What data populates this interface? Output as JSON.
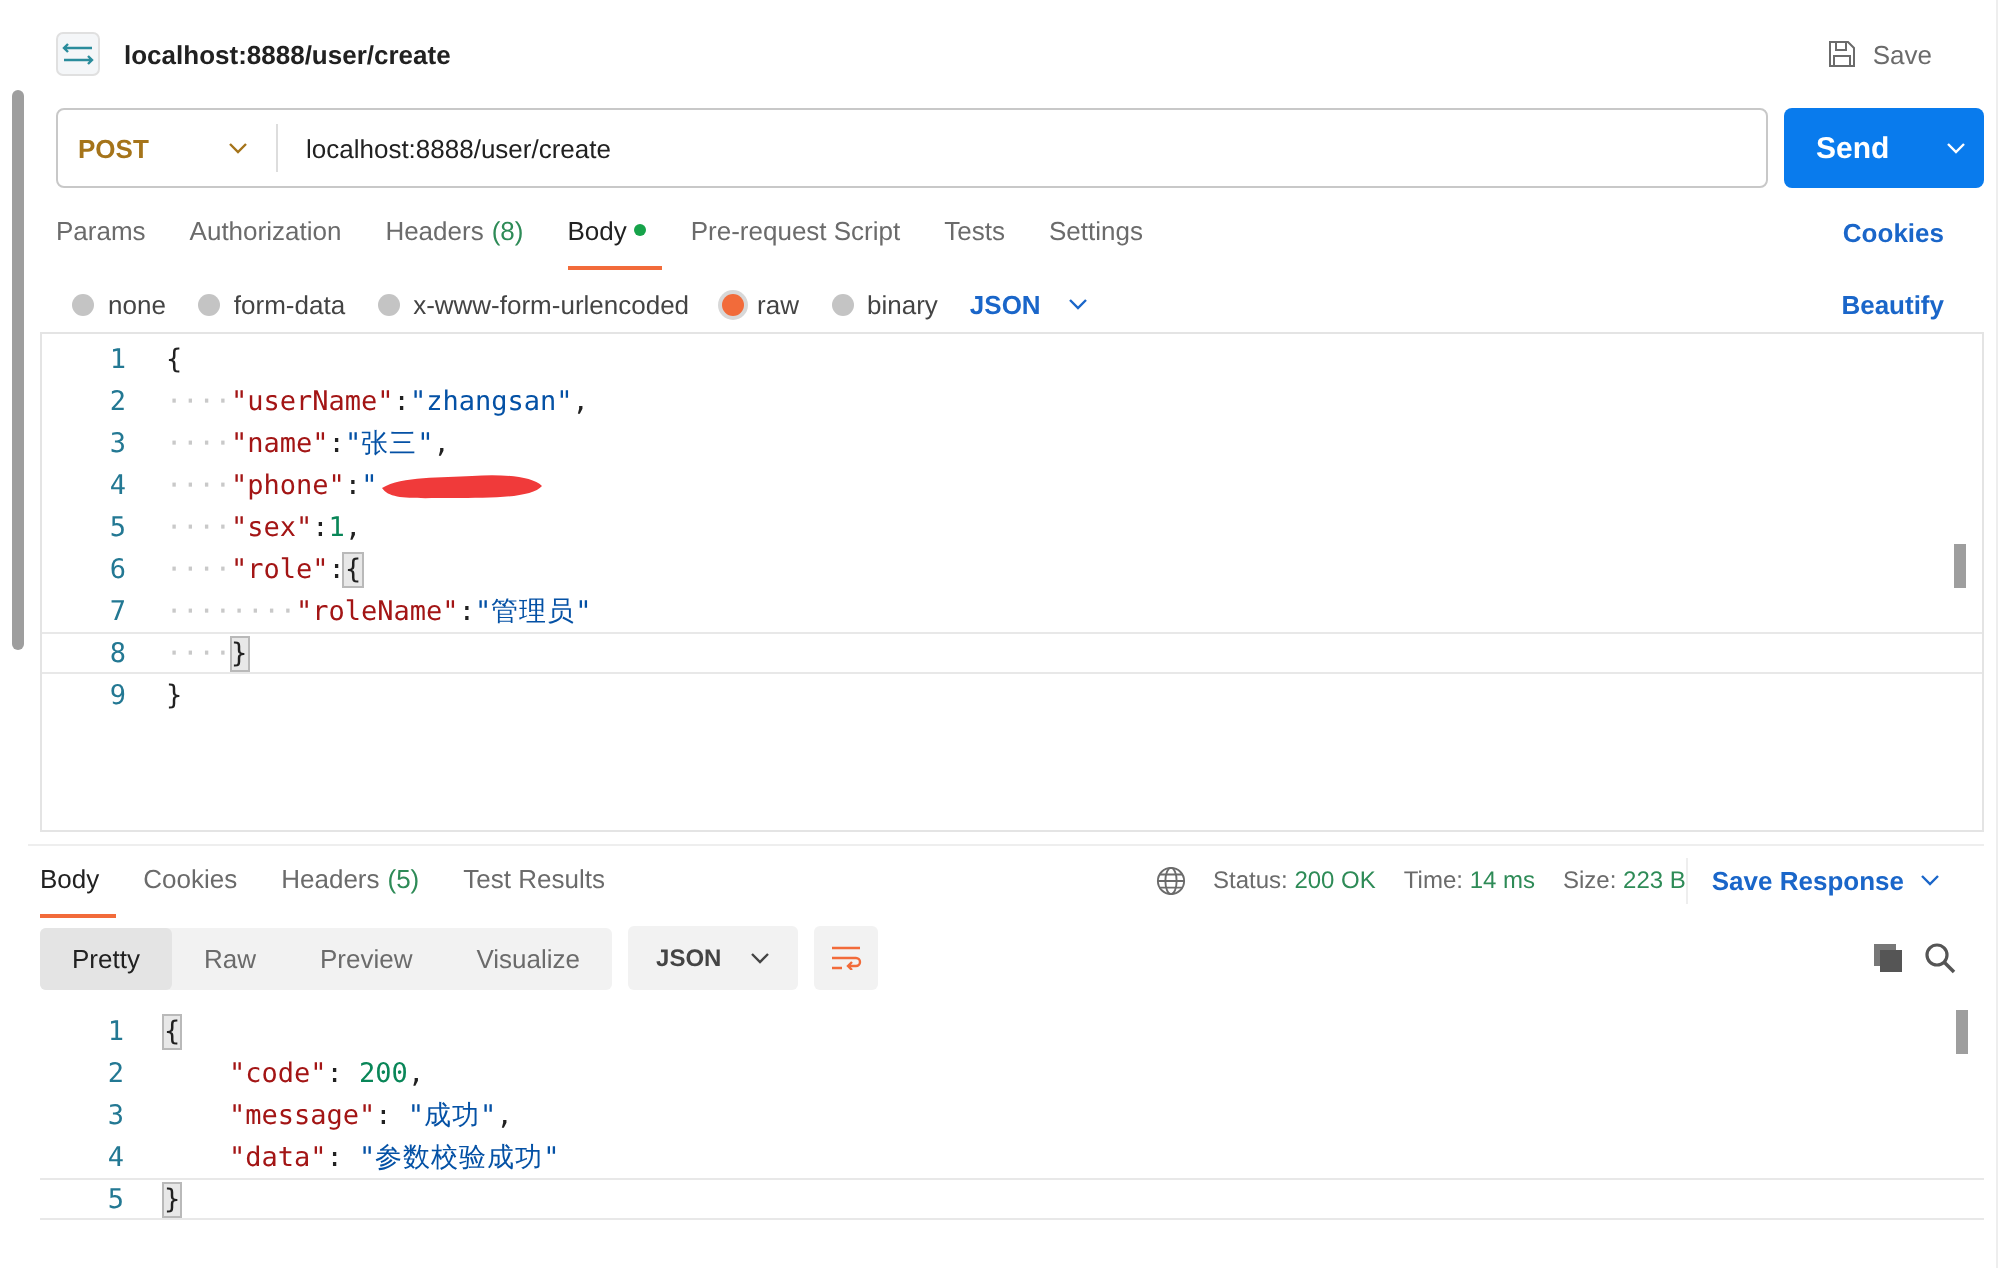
{
  "request": {
    "title": "localhost:8888/user/create",
    "save_label": "Save",
    "method": "POST",
    "url": "localhost:8888/user/create",
    "send_label": "Send"
  },
  "request_tabs": [
    {
      "label": "Params",
      "selected": false,
      "dot": false
    },
    {
      "label": "Authorization",
      "selected": false,
      "dot": false
    },
    {
      "label": "Headers",
      "count": "(8)",
      "selected": false,
      "dot": false
    },
    {
      "label": "Body",
      "selected": true,
      "dot": true
    },
    {
      "label": "Pre-request Script",
      "selected": false,
      "dot": false
    },
    {
      "label": "Tests",
      "selected": false,
      "dot": false
    },
    {
      "label": "Settings",
      "selected": false,
      "dot": false
    }
  ],
  "cookies_link": "Cookies",
  "body_modes": [
    {
      "label": "none",
      "selected": false
    },
    {
      "label": "form-data",
      "selected": false
    },
    {
      "label": "x-www-form-urlencoded",
      "selected": false
    },
    {
      "label": "raw",
      "selected": true
    },
    {
      "label": "binary",
      "selected": false
    }
  ],
  "body_format": "JSON",
  "beautify_label": "Beautify",
  "request_body": [
    {
      "number": "1",
      "current": false,
      "tokens": [
        {
          "kind": "bracket",
          "text": "{",
          "matched": false
        }
      ]
    },
    {
      "number": "2",
      "current": false,
      "indent": "····",
      "tokens": [
        {
          "kind": "key",
          "text": "\"userName\""
        },
        {
          "kind": "punct",
          "text": ":"
        },
        {
          "kind": "string",
          "text": "\"zhangsan\""
        },
        {
          "kind": "punct",
          "text": ","
        }
      ]
    },
    {
      "number": "3",
      "current": false,
      "indent": "····",
      "tokens": [
        {
          "kind": "key",
          "text": "\"name\""
        },
        {
          "kind": "punct",
          "text": ":"
        },
        {
          "kind": "string",
          "text": "\"张三\""
        },
        {
          "kind": "punct",
          "text": ","
        }
      ]
    },
    {
      "number": "4",
      "current": false,
      "indent": "····",
      "tokens": [
        {
          "kind": "key",
          "text": "\"phone\""
        },
        {
          "kind": "punct",
          "text": ":"
        },
        {
          "kind": "string",
          "text": "\""
        },
        {
          "kind": "redaction"
        }
      ]
    },
    {
      "number": "5",
      "current": false,
      "indent": "····",
      "tokens": [
        {
          "kind": "key",
          "text": "\"sex\""
        },
        {
          "kind": "punct",
          "text": ":"
        },
        {
          "kind": "number",
          "text": "1"
        },
        {
          "kind": "punct",
          "text": ","
        }
      ]
    },
    {
      "number": "6",
      "current": false,
      "indent": "····",
      "tokens": [
        {
          "kind": "key",
          "text": "\"role\""
        },
        {
          "kind": "punct",
          "text": ":"
        },
        {
          "kind": "bracket",
          "text": "{",
          "matched": true
        }
      ]
    },
    {
      "number": "7",
      "current": false,
      "indent": "········",
      "tokens": [
        {
          "kind": "key",
          "text": "\"roleName\""
        },
        {
          "kind": "punct",
          "text": ":"
        },
        {
          "kind": "string",
          "text": "\"管理员\""
        }
      ]
    },
    {
      "number": "8",
      "current": true,
      "indent": "····",
      "tokens": [
        {
          "kind": "bracket",
          "text": "}",
          "matched": true
        }
      ]
    },
    {
      "number": "9",
      "current": false,
      "tokens": [
        {
          "kind": "bracket",
          "text": "}",
          "matched": false
        }
      ]
    }
  ],
  "response_tabs": [
    {
      "label": "Body",
      "selected": true
    },
    {
      "label": "Cookies",
      "selected": false
    },
    {
      "label": "Headers",
      "count": "(5)",
      "selected": false
    },
    {
      "label": "Test Results",
      "selected": false
    }
  ],
  "response_meta": [
    {
      "label": "Status:",
      "value": "200 OK"
    },
    {
      "label": "Time:",
      "value": "14 ms"
    },
    {
      "label": "Size:",
      "value": "223 B"
    }
  ],
  "save_response": "Save Response",
  "view_modes": [
    {
      "label": "Pretty",
      "selected": true
    },
    {
      "label": "Raw",
      "selected": false
    },
    {
      "label": "Preview",
      "selected": false
    },
    {
      "label": "Visualize",
      "selected": false
    }
  ],
  "response_format": "JSON",
  "response_body": [
    {
      "number": "1",
      "current": false,
      "nested": false,
      "tokens": [
        {
          "kind": "bracket",
          "text": "{",
          "matched": true
        }
      ]
    },
    {
      "number": "2",
      "current": false,
      "nested": true,
      "tokens": [
        {
          "kind": "key",
          "text": "\"code\""
        },
        {
          "kind": "punct",
          "text": ": "
        },
        {
          "kind": "number",
          "text": "200"
        },
        {
          "kind": "punct",
          "text": ","
        }
      ]
    },
    {
      "number": "3",
      "current": false,
      "nested": true,
      "tokens": [
        {
          "kind": "key",
          "text": "\"message\""
        },
        {
          "kind": "punct",
          "text": ": "
        },
        {
          "kind": "string",
          "text": "\"成功\""
        },
        {
          "kind": "punct",
          "text": ","
        }
      ]
    },
    {
      "number": "4",
      "current": false,
      "nested": true,
      "tokens": [
        {
          "kind": "key",
          "text": "\"data\""
        },
        {
          "kind": "punct",
          "text": ": "
        },
        {
          "kind": "string",
          "text": "\"参数校验成功\""
        }
      ]
    },
    {
      "number": "5",
      "current": true,
      "nested": false,
      "tokens": [
        {
          "kind": "bracket",
          "text": "}",
          "matched": true
        }
      ]
    }
  ]
}
